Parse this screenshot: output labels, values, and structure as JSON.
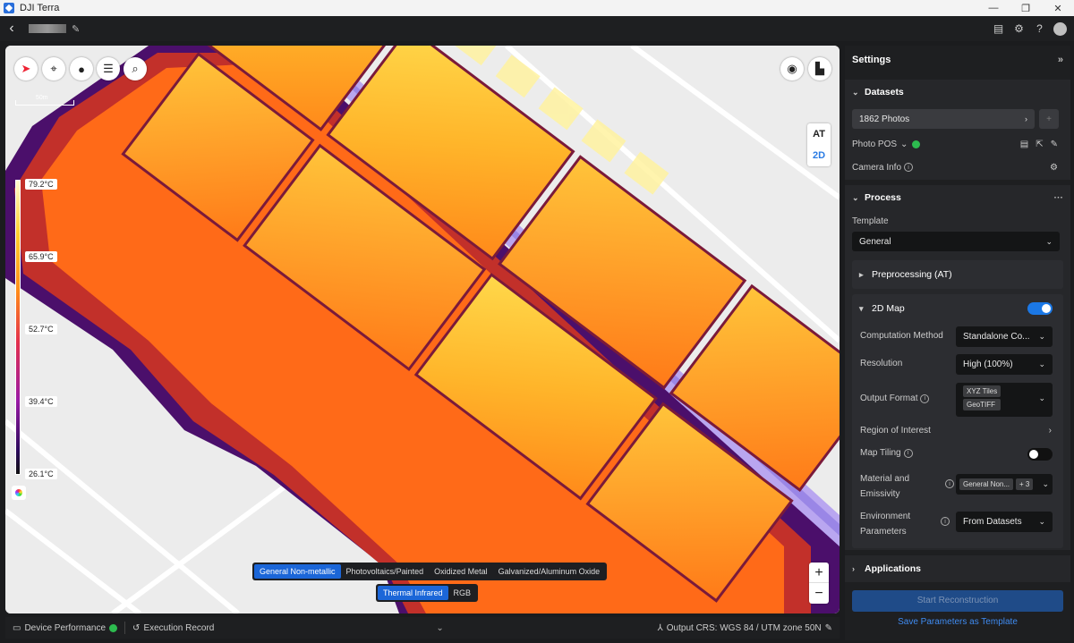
{
  "window": {
    "title": "DJI Terra",
    "controls": [
      "—",
      "❐",
      "✕"
    ]
  },
  "appbar": {
    "back_icon": "chevron-left-icon",
    "edit_icon": "pencil-icon",
    "right_icons": [
      "report-icon",
      "gear-icon",
      "help-icon",
      "user-icon"
    ]
  },
  "map": {
    "scale_label": "50m",
    "legend_ticks": [
      "79.2°C",
      "65.9°C",
      "52.7°C",
      "39.4°C",
      "26.1°C"
    ],
    "view_toggle": {
      "top": "AT",
      "bottom": "2D",
      "active": "2D"
    },
    "material_segments": [
      "General Non-metallic",
      "Photovoltaics/Painted",
      "Oxidized Metal",
      "Galvanized/Aluminum Oxide"
    ],
    "material_selected": "General Non-metallic",
    "mode_segments": [
      "Thermal Infrared",
      "RGB"
    ],
    "mode_selected": "Thermal Infrared",
    "zoom_in": "+",
    "zoom_out": "−",
    "colors": {
      "accent": "#1b66d8",
      "road_label": "#8c7bd8"
    }
  },
  "statusbar": {
    "device_performance": "Device Performance",
    "execution_record": "Execution Record",
    "output_crs": "Output CRS: WGS 84 / UTM zone 50N"
  },
  "settings": {
    "title": "Settings",
    "datasets": {
      "title": "Datasets",
      "photos": "1862 Photos",
      "add": "+",
      "photo_pos": "Photo POS",
      "camera_info": "Camera Info"
    },
    "process": {
      "title": "Process",
      "more": "···",
      "template_label": "Template",
      "template_value": "General",
      "preprocessing": "Preprocessing (AT)",
      "map2d": {
        "title": "2D Map",
        "enabled": true,
        "computation_method_label": "Computation Method",
        "computation_method_value": "Standalone Co...",
        "resolution_label": "Resolution",
        "resolution_value": "High (100%)",
        "output_format_label": "Output Format",
        "output_format_values": [
          "XYZ Tiles",
          "GeoTIFF"
        ],
        "roi_label": "Region of Interest",
        "map_tiling_label": "Map Tiling",
        "map_tiling_enabled": false,
        "material_label_1": "Material and",
        "material_label_2": "Emissivity",
        "material_value": "General Non...",
        "material_extra": "+ 3",
        "env_label_1": "Environment",
        "env_label_2": "Parameters",
        "env_value": "From Datasets"
      }
    },
    "applications": "Applications",
    "start_button": "Start Reconstruction",
    "save_template": "Save Parameters as Template"
  }
}
